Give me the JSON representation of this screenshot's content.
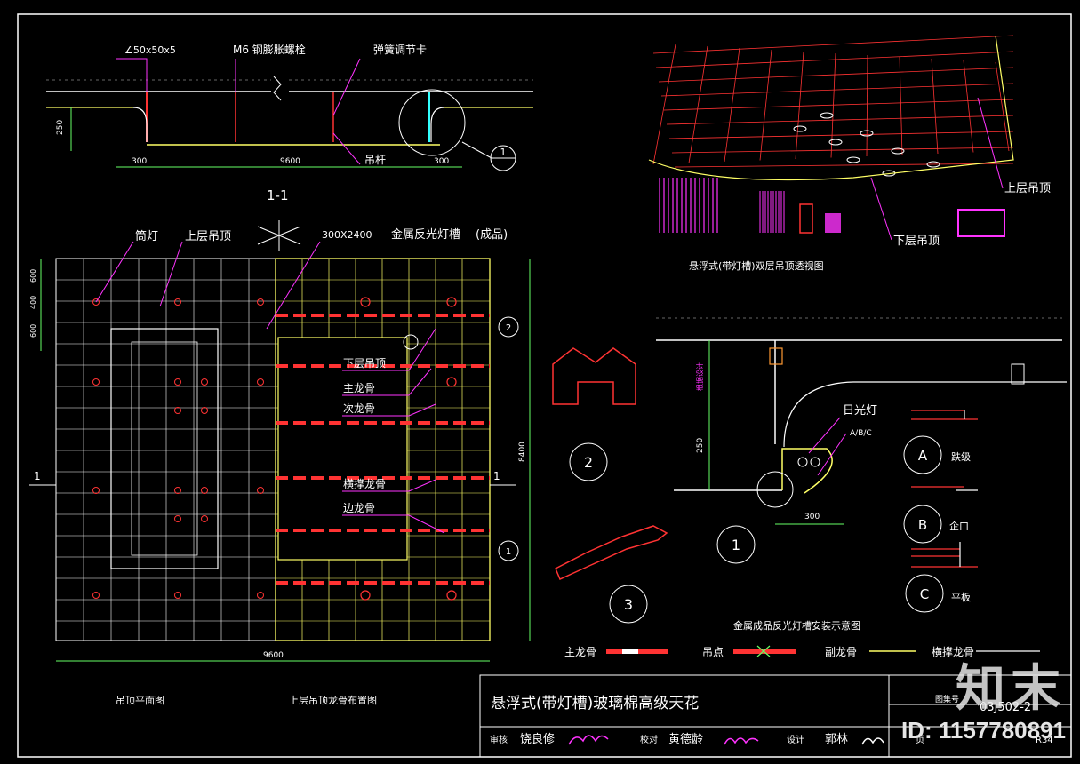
{
  "section": {
    "angle_label": "∠50x50x5",
    "bolt_label": "M6  钢膨胀螺栓",
    "spring_label": "弹簧调节卡",
    "hanger_label": "吊杆",
    "dim_height": "250",
    "dim_left": "300",
    "dim_mid": "9600",
    "dim_right": "300",
    "detail_no": "1",
    "section_title": "1-1"
  },
  "plan": {
    "lamp_label": "筒灯",
    "upper_ceiling_label": "上层吊顶",
    "grid_size_label": "300X2400",
    "trough_label": "金属反光灯槽",
    "finished_label": "(成品)",
    "lower_ceiling_label": "下层吊顶",
    "main_keel_label": "主龙骨",
    "secondary_keel_label": "次龙骨",
    "support_keel_label": "横撑龙骨",
    "edge_keel_label": "边龙骨",
    "dim_600": "600",
    "dim_400": "400",
    "dim_8400": "8400",
    "dim_9600": "9600",
    "section_mark": "1",
    "callout_2": "2",
    "callout_1": "1",
    "title_left": "吊顶平面图",
    "title_right": "上层吊顶龙骨布置图"
  },
  "perspective": {
    "upper_label": "上层吊顶",
    "lower_label": "下层吊顶",
    "caption": "悬浮式(带灯槽)双层吊顶透视图"
  },
  "install": {
    "fluorescent_label": "日光灯",
    "abc_label": "A/B/C",
    "dim_250": "250",
    "dim_300": "300",
    "dim_v": "根据设计",
    "caption": "金属成品反光灯槽安装示意图",
    "circle_1": "1",
    "circle_2": "2",
    "circle_3": "3",
    "type_a": "A",
    "type_a_label": "跌级",
    "type_b": "B",
    "type_b_label": "企口",
    "type_c": "C",
    "type_c_label": "平板"
  },
  "legend": {
    "main_keel": "主龙骨",
    "hang_point": "吊点",
    "sub_keel": "副龙骨",
    "support_keel": "横撑龙骨"
  },
  "title_block": {
    "title": "悬浮式(带灯槽)玻璃棉高级天花",
    "atlas_label": "图集号",
    "atlas_no": "03J502-2",
    "review": "审核",
    "reviewer": "饶良修",
    "check": "校对",
    "checker": "黄德龄",
    "design": "设计",
    "designer": "郭林",
    "page_label": "页",
    "page_no": "R34"
  },
  "watermark": {
    "brand": "知末",
    "id": "ID: 1157780891"
  },
  "colors": {
    "background": "#000000",
    "white": "#ffffff",
    "yellow": "#ffff66",
    "red": "#ff3333",
    "magenta": "#ff33ff",
    "cyan": "#33ffff",
    "green": "#66ff66",
    "orange": "#ff9933",
    "gray": "#888888"
  }
}
